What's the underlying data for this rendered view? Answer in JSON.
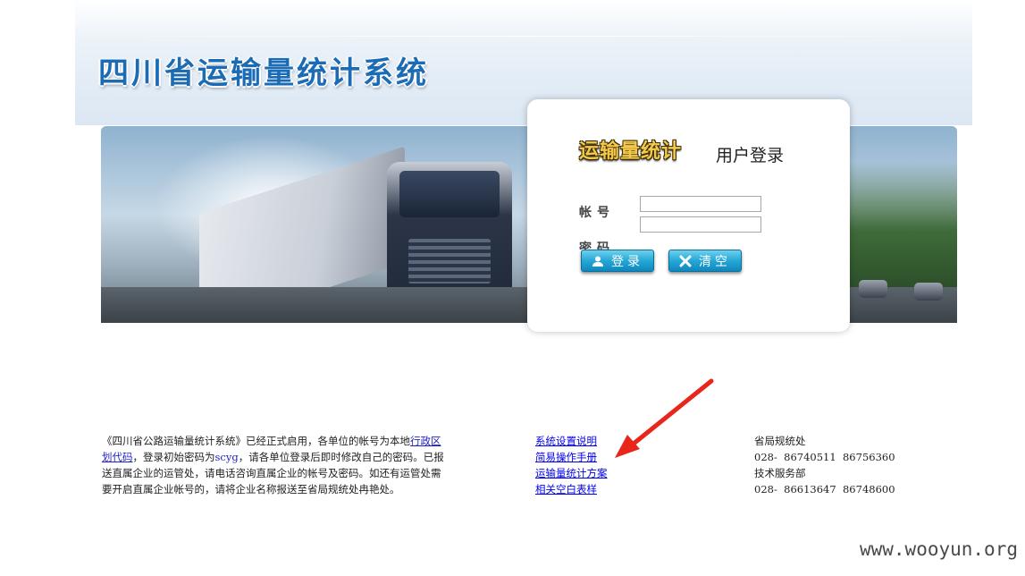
{
  "header": {
    "title": "四川省运输量统计系统"
  },
  "login": {
    "logo_text": "运输量统计",
    "heading": "用户登录",
    "account_label": "帐号",
    "password_label": "密码",
    "login_button": "登录",
    "clear_button": "清空"
  },
  "notice": {
    "part1": "《四川省公路运输量统计系统》已经正式启用，各单位的帐号为本地",
    "link": "行政区划代码",
    "part2": "，登录初始密码为",
    "default_password": "scyg",
    "part3": "，请各单位登录后即时修改自己的密码。已报送直属企业的运管处，请电话咨询直属企业的帐号及密码。如还有运管处需要开启直属企业帐号的，请将企业名称报送至省局规统处冉艳处。"
  },
  "doc_links": [
    "系统设置说明",
    "简易操作手册",
    "运输量统计方案",
    "相关空白表样"
  ],
  "contacts": [
    {
      "dept": "省局规统处",
      "phone": "028-  86740511  86756360"
    },
    {
      "dept": "技术服务部",
      "phone": "028-  86613647  86748600"
    }
  ],
  "watermark": "www.wooyun.org",
  "colors": {
    "title_blue": "#1b6cb5",
    "button_blue": "#25a7d6",
    "arrow_red": "#e8261c",
    "link_blue": "#0000ee"
  },
  "icons": {
    "login": "user-icon",
    "clear": "close-icon"
  }
}
